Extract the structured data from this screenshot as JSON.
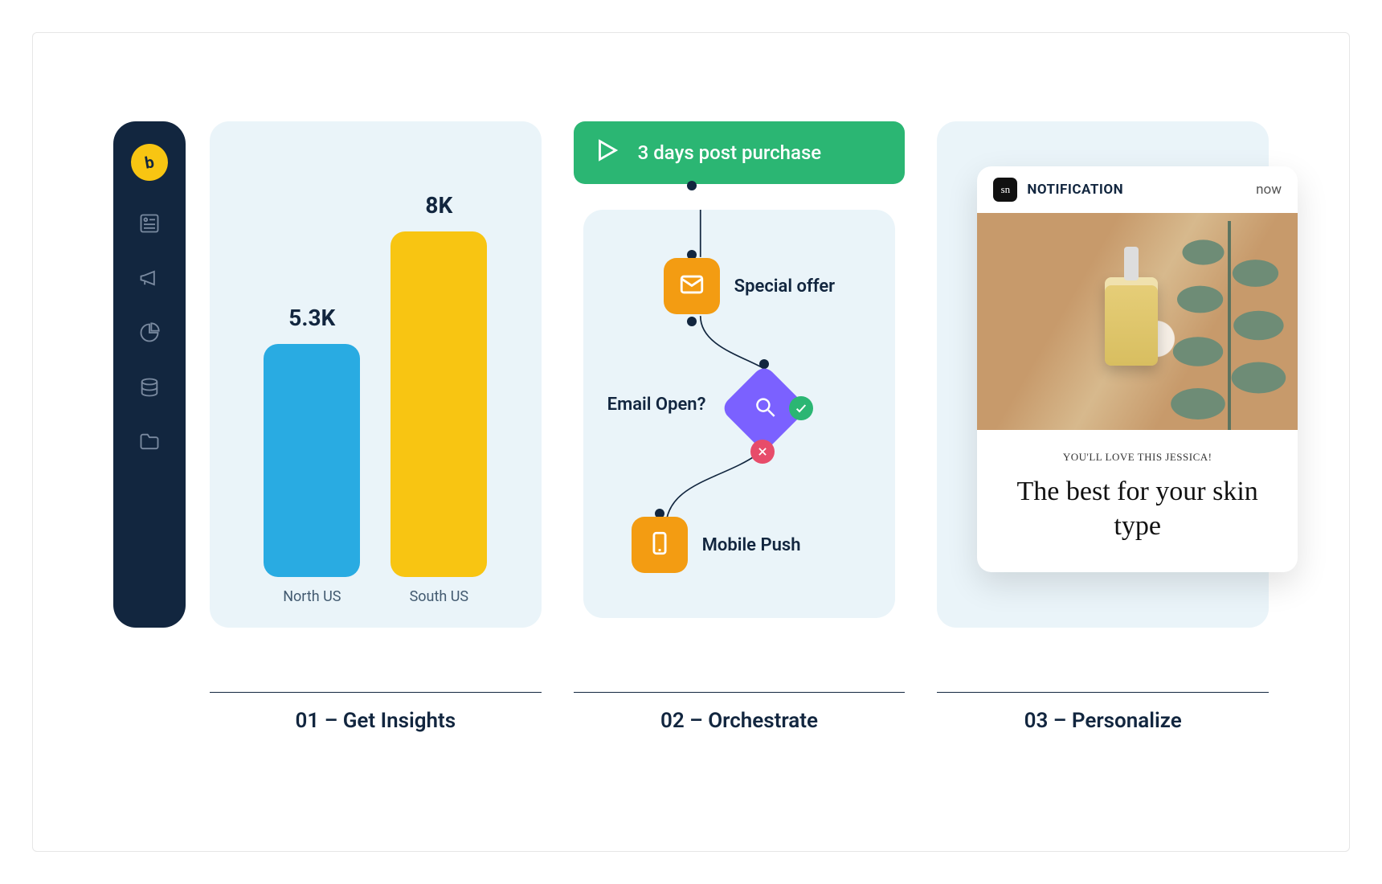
{
  "sidebar": {
    "logo_glyph": "b",
    "icons": [
      "dashboard",
      "megaphone",
      "pie-chart",
      "database",
      "folder"
    ]
  },
  "panel1": {
    "caption": "01 – Get Insights"
  },
  "panel2": {
    "caption": "02 – Orchestrate",
    "trigger_label": "3 days post purchase",
    "node_email_label": "Special offer",
    "decision_label": "Email Open?",
    "node_push_label": "Mobile Push"
  },
  "panel3": {
    "caption": "03 – Personalize",
    "notification": {
      "badge_text": "sn",
      "title": "NOTIFICATION",
      "time": "now",
      "eyebrow": "YOU'LL LOVE THIS JESSICA!",
      "headline": "The best for your skin type"
    }
  },
  "chart_data": {
    "type": "bar",
    "categories": [
      "North US",
      "South US"
    ],
    "values": [
      5300,
      8000
    ],
    "display_values": [
      "5.3K",
      "8K"
    ],
    "colors": [
      "#29abe2",
      "#f8c512"
    ],
    "title": "",
    "xlabel": "",
    "ylabel": "",
    "ylim": [
      0,
      9000
    ]
  }
}
